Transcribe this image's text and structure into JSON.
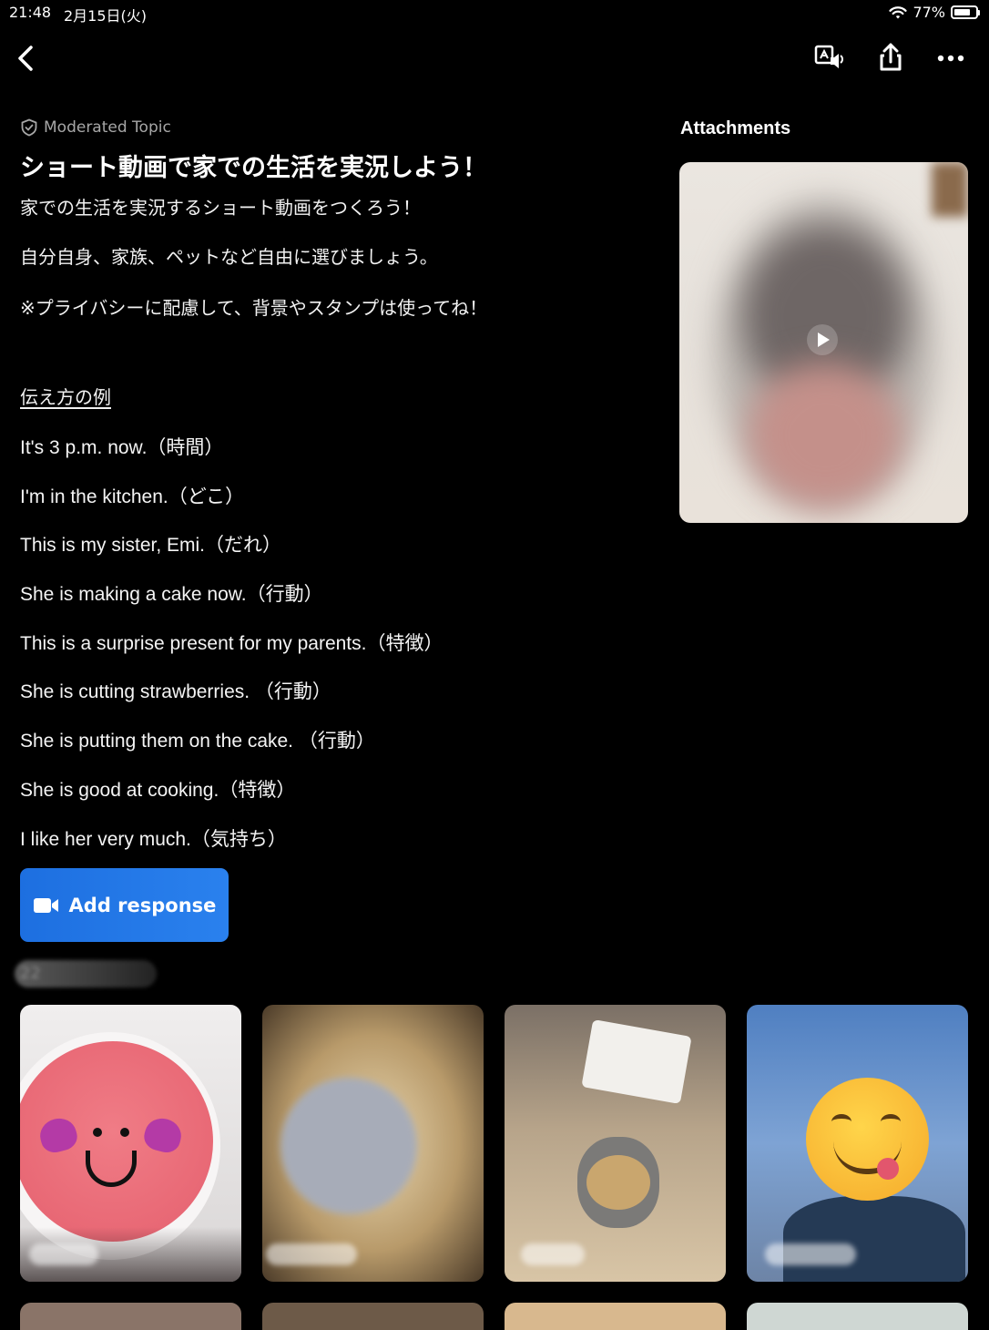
{
  "status_bar": {
    "time": "21:48",
    "date": "2月15日(火)",
    "battery": "77%",
    "battery_level": 0.77
  },
  "nav": {
    "back_icon": "chevron-left-icon",
    "translate_icon": "translate-audio-icon",
    "share_icon": "share-icon",
    "more_icon": "more-dots-icon"
  },
  "topic": {
    "moderated_label": "Moderated Topic",
    "title": "ショート動画で家での生活を実況しよう！",
    "lines": [
      "家での生活を実況するショート動画をつくろう！",
      "自分自身、家族、ペットなど自由に選びましょう。",
      "※プライバシーに配慮して、背景やスタンプは使ってね！"
    ],
    "examples_header": "伝え方の例",
    "examples": [
      "It's 3 p.m. now.（時間）",
      "I'm in the kitchen.（どこ）",
      "This is my sister, Emi.（だれ）",
      "She is making a cake now.（行動）",
      "This is a surprise present for my parents.（特徴）",
      "She is cutting strawberries. （行動）",
      "She is putting them on the cake. （行動）",
      "She is good at cooking.（特徴）",
      "I like her very much.（気持ち）"
    ]
  },
  "add_response": {
    "label": "Add response",
    "icon": "video-camera-icon"
  },
  "responses": {
    "count_label": "22"
  },
  "attachments": {
    "title": "Attachments"
  },
  "colors": {
    "background": "#000000",
    "accent": "#1f73e6",
    "muted_text": "#a7a7a7"
  }
}
